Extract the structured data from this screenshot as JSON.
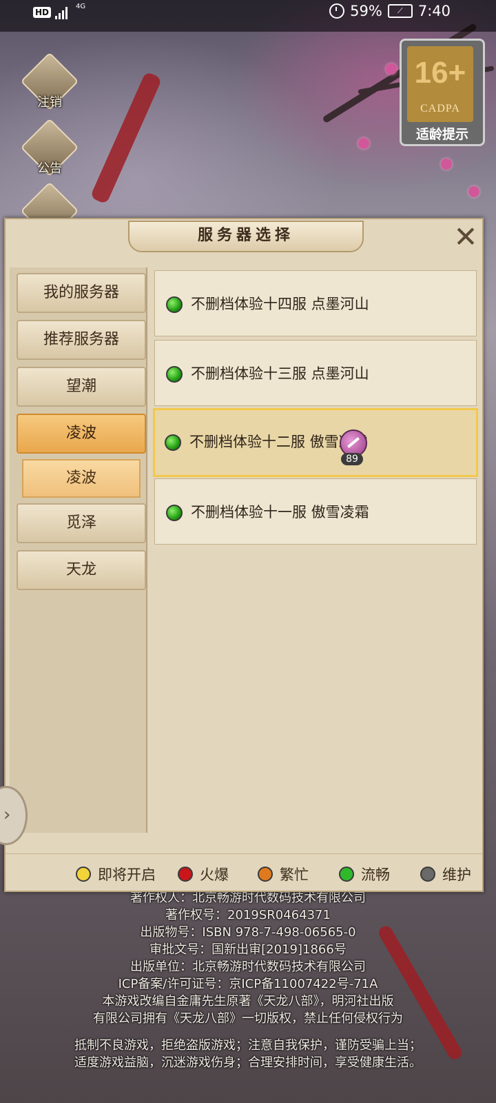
{
  "status_bar": {
    "hd": "HD",
    "network": "4G",
    "battery_percent": "59%",
    "time": "7:40"
  },
  "side_menu": [
    {
      "label": "注销",
      "icon": "logout-icon"
    },
    {
      "label": "公告",
      "icon": "megaphone-icon"
    }
  ],
  "age_rating": {
    "age": "16+",
    "org": "CADPA",
    "tip": "适龄提示"
  },
  "dialog": {
    "title": "服务器选择",
    "close_label": "✕",
    "categories": [
      {
        "label": "我的服务器",
        "active": false
      },
      {
        "label": "推荐服务器",
        "active": false
      },
      {
        "label": "望潮",
        "active": false
      },
      {
        "label": "凌波",
        "active": true
      },
      {
        "label": "觅泽",
        "active": false
      },
      {
        "label": "天龙",
        "active": false
      }
    ],
    "sub_category": "凌波",
    "servers": [
      {
        "name": "不删档体验十四服 点墨河山",
        "status": "流畅",
        "selected": false
      },
      {
        "name": "不删档体验十三服 点墨河山",
        "status": "流畅",
        "selected": false
      },
      {
        "name": "不删档体验十二服 傲雪凌霜",
        "status": "流畅",
        "selected": true,
        "player_level": "89"
      },
      {
        "name": "不删档体验十一服 傲雪凌霜",
        "status": "流畅",
        "selected": false
      }
    ],
    "legend": [
      {
        "label": "即将开启",
        "color": "#f2d43a"
      },
      {
        "label": "火爆",
        "color": "#c8161b"
      },
      {
        "label": "繁忙",
        "color": "#e07a1f"
      },
      {
        "label": "流畅",
        "color": "#2fb82a"
      },
      {
        "label": "维护",
        "color": "#6a6a6a"
      }
    ]
  },
  "footer": {
    "line1": "著作权人：北京畅游时代数码技术有限公司",
    "line2": "著作权号：2019SR0464371",
    "line3": "出版物号：ISBN 978-7-498-06565-0",
    "line4": "审批文号：国新出审[2019]1866号",
    "line5": "出版单位：北京畅游时代数码技术有限公司",
    "line6": "ICP备案/许可证号：京ICP备11007422号-71A",
    "line7": "本游戏改编自金庸先生原著《天龙八部》，明河社出版",
    "line8": "有限公司拥有《天龙八部》一切版权，禁止任何侵权行为",
    "line9": "抵制不良游戏，拒绝盗版游戏；注意自我保护，谨防受骗上当；",
    "line10": "适度游戏益脑，沉迷游戏伤身；合理安排时间，享受健康生活。"
  }
}
